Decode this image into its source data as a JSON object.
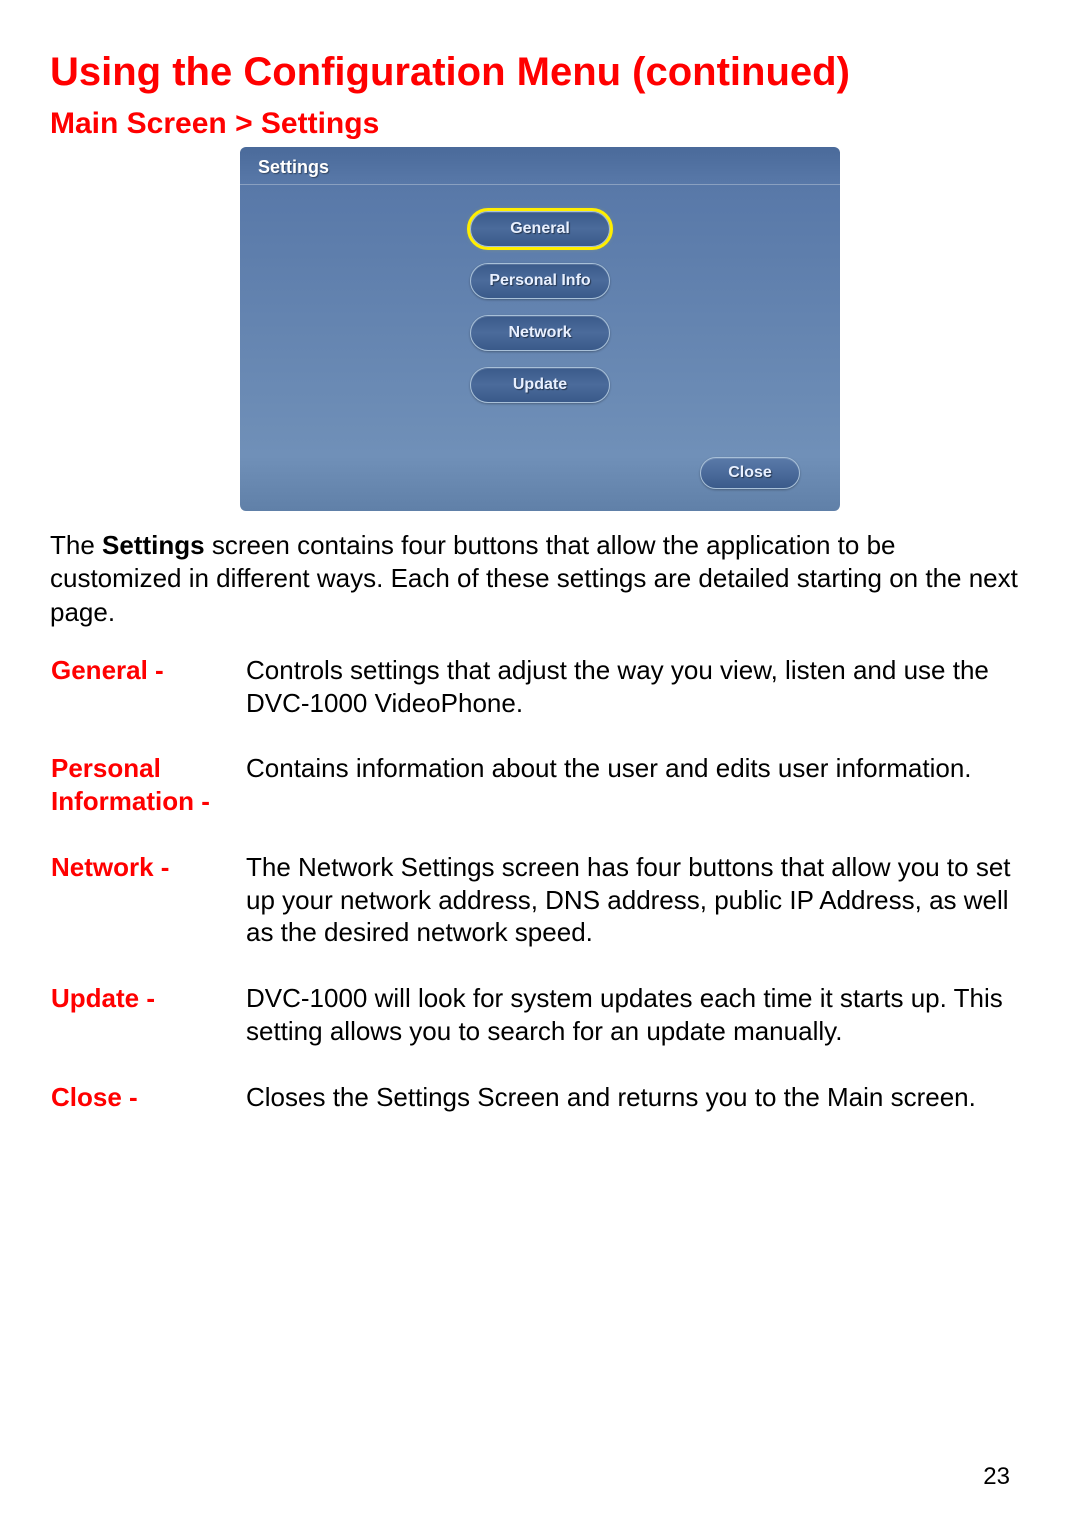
{
  "title": "Using the Configuration Menu (continued)",
  "subtitle": "Main Screen > Settings",
  "settings_panel": {
    "header": "Settings",
    "buttons": {
      "general": "General",
      "personal": "Personal Info",
      "network": "Network",
      "update": "Update"
    },
    "close": "Close"
  },
  "intro_pre": "The ",
  "intro_bold": "Settings",
  "intro_post": " screen contains four buttons that allow the application to be customized in different ways. Each of these settings are detailed starting on the next page.",
  "descriptions": [
    {
      "label": "General -",
      "text": "Controls settings that adjust the way you view, listen and use the DVC-1000 VideoPhone."
    },
    {
      "label": "Personal Information -",
      "text": "Contains information about the user and edits user information."
    },
    {
      "label": "Network -",
      "text": "The Network Settings screen has four buttons that allow you to set up your network address, DNS address, public IP Address, as well as the desired network speed."
    },
    {
      "label": "Update -",
      "text": "DVC-1000 will look for system updates each time it starts up. This setting allows you to search for an update manually."
    },
    {
      "label": "Close -",
      "text": "Closes the Settings Screen and returns you to the Main screen."
    }
  ],
  "page_number": "23"
}
